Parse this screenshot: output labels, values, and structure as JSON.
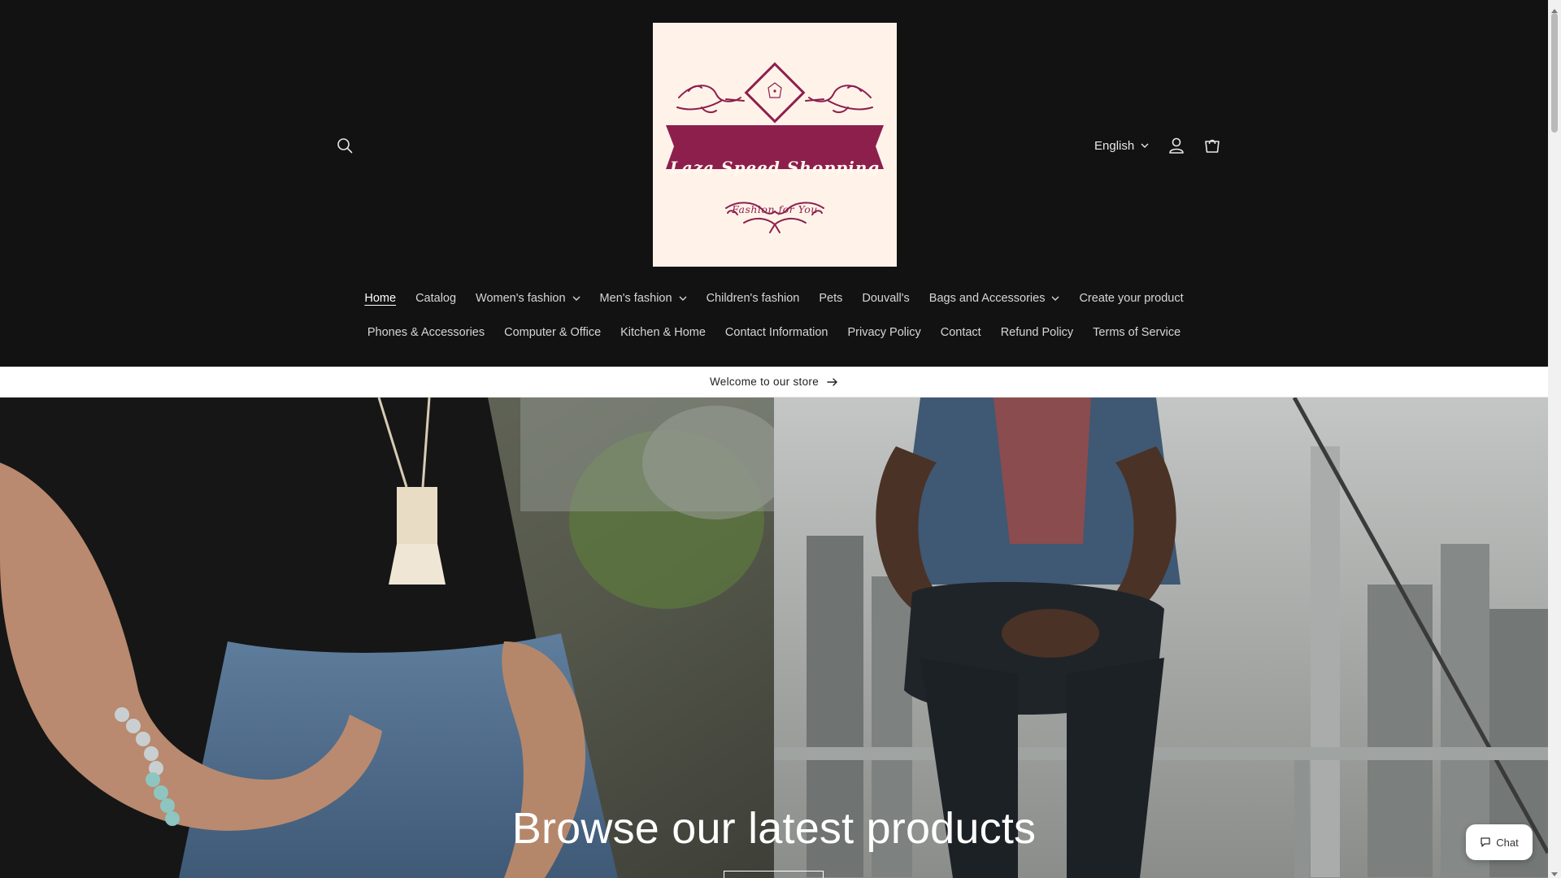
{
  "header": {
    "language": "English"
  },
  "logo": {
    "title": "Laza Speed Shopping",
    "subtitle": "Fashion for You",
    "brand_color": "#8d1f4d",
    "background": "#fff3e9"
  },
  "nav": {
    "row1": [
      {
        "label": "Home",
        "active": true
      },
      {
        "label": "Catalog"
      },
      {
        "label": "Women's fashion",
        "dropdown": true
      },
      {
        "label": "Men's fashion",
        "dropdown": true
      },
      {
        "label": "Children's fashion"
      },
      {
        "label": "Pets"
      },
      {
        "label": "Douvall's"
      },
      {
        "label": "Bags and Accessories",
        "dropdown": true
      },
      {
        "label": "Create your product"
      }
    ],
    "row2": [
      {
        "label": "Phones & Accessories"
      },
      {
        "label": "Computer & Office"
      },
      {
        "label": "Kitchen & Home"
      },
      {
        "label": "Contact Information"
      },
      {
        "label": "Privacy Policy"
      },
      {
        "label": "Contact"
      },
      {
        "label": "Refund Policy"
      },
      {
        "label": "Terms of Service"
      }
    ]
  },
  "announcement": {
    "text": "Welcome to our store"
  },
  "hero": {
    "heading": "Browse our latest products"
  },
  "chat": {
    "label": "Chat"
  },
  "icons": {
    "search": "search-icon",
    "account": "account-icon",
    "cart": "cart-icon",
    "chat": "chat-bubble-icon"
  },
  "colors": {
    "header_bg": "#121212",
    "nav_text": "#d6d6d6",
    "announcement_bg": "#ffffff"
  }
}
